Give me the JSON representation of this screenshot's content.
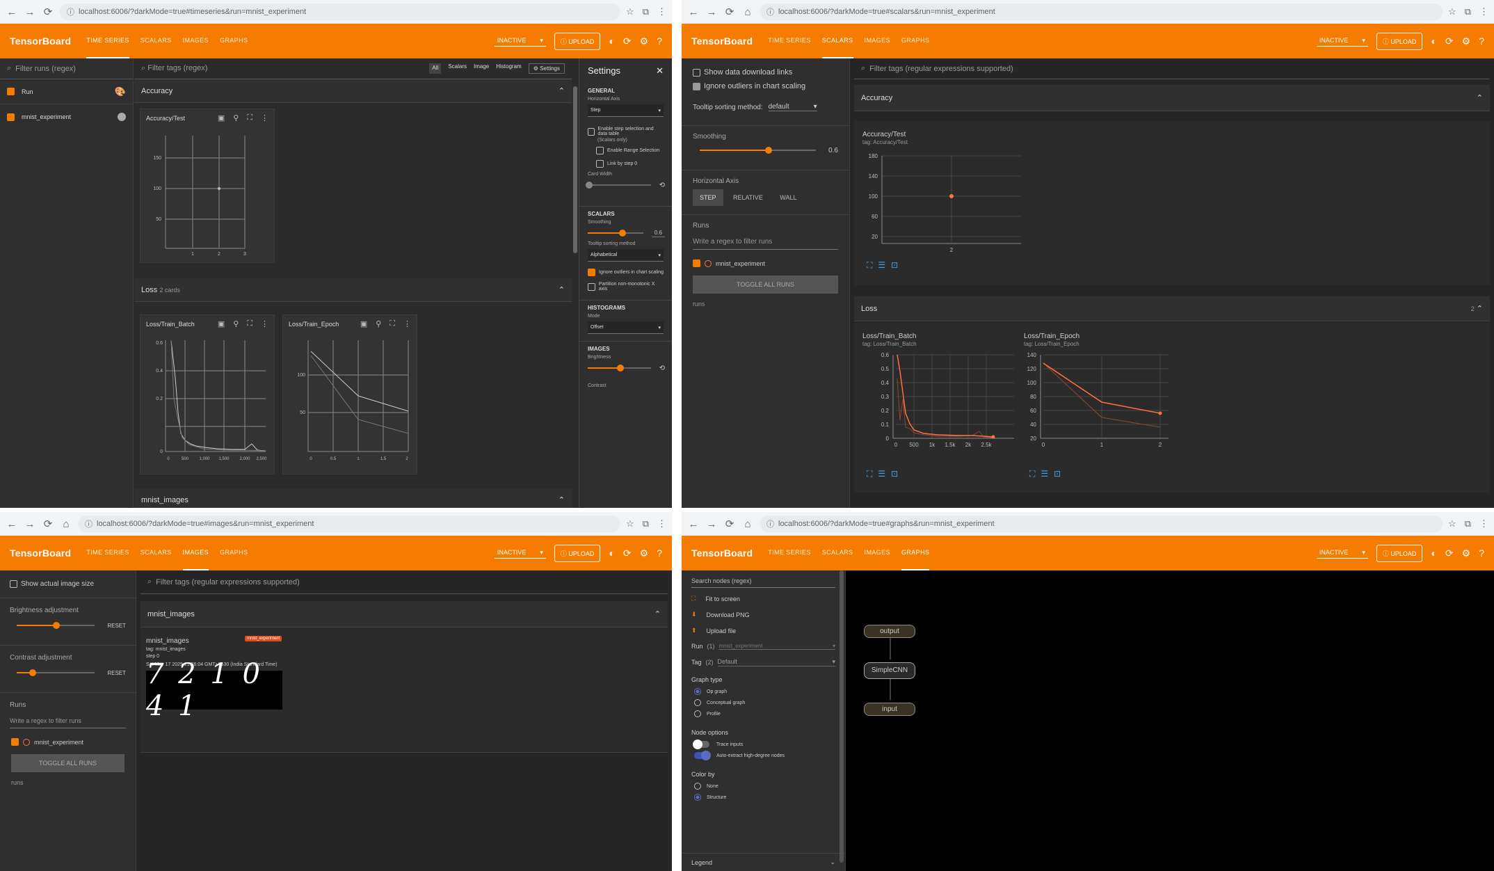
{
  "q1": {
    "url": "localhost:6006/?darkMode=true#timeseries&run=mnist_experiment",
    "brand": "TensorBoard",
    "tabs": [
      "TIME SERIES",
      "SCALARS",
      "IMAGES",
      "GRAPHS"
    ],
    "inactive": "INACTIVE",
    "upload": "UPLOAD",
    "filter_runs": "Filter runs (regex)",
    "runs": [
      "Run",
      "mnist_experiment"
    ],
    "filter_tags": "Filter tags (regex)",
    "type_tabs": [
      "All",
      "Scalars",
      "Image",
      "Histogram"
    ],
    "settings_btn": "Settings",
    "section_accuracy": "Accuracy",
    "accuracy_card": {
      "title": "Accuracy/Test",
      "yticks": [
        "150",
        "100",
        "50"
      ],
      "xticks": [
        "1",
        "2",
        "3"
      ]
    },
    "section_loss": "Loss",
    "section_loss_count": "2 cards",
    "loss_batch": {
      "title": "Loss/Train_Batch",
      "yticks": [
        "0.6",
        "0.4",
        "0.2",
        "0"
      ],
      "xticks": [
        "0",
        "500",
        "1,000",
        "1,500",
        "2,000",
        "2,500"
      ]
    },
    "loss_epoch": {
      "title": "Loss/Train_Epoch",
      "yticks": [
        "100",
        "50"
      ],
      "xticks": [
        "0",
        "0.5",
        "1",
        "1.5",
        "2"
      ]
    },
    "section_images": "mnist_images",
    "settings": {
      "title": "Settings",
      "general": "GENERAL",
      "horizontal_axis": "Horizontal Axis",
      "axis_value": "Step",
      "enable_step": "Enable step selection and data table",
      "scalars_only": "(Scalars only)",
      "enable_range": "Enable Range Selection",
      "link_step": "Link by step 0",
      "card_width": "Card Width",
      "scalars": "SCALARS",
      "smoothing": "Smoothing",
      "smoothing_value": "0.6",
      "tooltip_sort": "Tooltip sorting method",
      "tooltip_value": "Alphabetical",
      "ignore_outliers": "Ignore outliers in chart scaling",
      "partition": "Partition non-monotonic X axis",
      "histograms": "HISTOGRAMS",
      "mode": "Mode",
      "mode_value": "Offset",
      "images": "IMAGES",
      "brightness": "Brightness",
      "contrast": "Contrast"
    }
  },
  "q2": {
    "url": "localhost:6006/?darkMode=true#scalars&run=mnist_experiment",
    "brand": "TensorBoard",
    "tabs": [
      "TIME SERIES",
      "SCALARS",
      "IMAGES",
      "GRAPHS"
    ],
    "inactive": "INACTIVE",
    "upload": "UPLOAD",
    "show_download": "Show data download links",
    "ignore_outliers": "Ignore outliers in chart scaling",
    "tooltip_label": "Tooltip sorting method:",
    "tooltip_value": "default",
    "smoothing": "Smoothing",
    "smoothing_value": "0.6",
    "horizontal_axis": "Horizontal Axis",
    "axis_options": [
      "STEP",
      "RELATIVE",
      "WALL"
    ],
    "runs_label": "Runs",
    "runs_filter": "Write a regex to filter runs",
    "run_name": "mnist_experiment",
    "toggle_all": "TOGGLE ALL RUNS",
    "runs_footer": "runs",
    "filter_tags": "Filter tags (regular expressions supported)",
    "section_accuracy": "Accuracy",
    "acc_chart": {
      "title": "Accuracy/Test",
      "tag": "tag: Accuracy/Test",
      "yticks": [
        "180",
        "140",
        "100",
        "60",
        "20"
      ],
      "xticks": [
        "2"
      ]
    },
    "section_loss": "Loss",
    "section_loss_count": "2",
    "batch_chart": {
      "title": "Loss/Train_Batch",
      "tag": "tag: Loss/Train_Batch",
      "yticks": [
        "0.6",
        "0.5",
        "0.4",
        "0.3",
        "0.2",
        "0.1",
        "0"
      ],
      "xticks": [
        "0",
        "500",
        "1k",
        "1.5k",
        "2k",
        "2.5k"
      ]
    },
    "epoch_chart": {
      "title": "Loss/Train_Epoch",
      "tag": "tag: Loss/Train_Epoch",
      "yticks": [
        "140",
        "120",
        "100",
        "80",
        "60",
        "40",
        "20"
      ],
      "xticks": [
        "0",
        "1",
        "2"
      ]
    }
  },
  "q3": {
    "url": "localhost:6006/?darkMode=true#images&run=mnist_experiment",
    "brand": "TensorBoard",
    "tabs": [
      "TIME SERIES",
      "SCALARS",
      "IMAGES",
      "GRAPHS"
    ],
    "inactive": "INACTIVE",
    "upload": "UPLOAD",
    "show_actual": "Show actual image size",
    "brightness": "Brightness adjustment",
    "contrast": "Contrast adjustment",
    "reset": "RESET",
    "runs_label": "Runs",
    "runs_filter": "Write a regex to filter runs",
    "run_name": "mnist_experiment",
    "toggle_all": "TOGGLE ALL RUNS",
    "runs_footer": "runs",
    "filter_tags": "Filter tags (regular expressions supported)",
    "section": "mnist_images",
    "card_title": "mnist_images",
    "card_badge": "mnist_experiment",
    "card_tag": "tag: mnist_images",
    "card_step": "step 0",
    "card_time": "Sat May 17 2025 21:26:04 GMT+0530 (India Standard Time)",
    "digits": "7 2 1 0 4 1"
  },
  "q4": {
    "url": "localhost:6006/?darkMode=true#graphs&run=mnist_experiment",
    "brand": "TensorBoard",
    "tabs": [
      "TIME SERIES",
      "SCALARS",
      "IMAGES",
      "GRAPHS"
    ],
    "inactive": "INACTIVE",
    "upload": "UPLOAD",
    "search": "Search nodes (regex)",
    "fit": "Fit to screen",
    "download": "Download PNG",
    "upload_file": "Upload file",
    "run_label": "Run",
    "run_count": "(1)",
    "run_value": "mnist_experiment",
    "tag_label": "Tag",
    "tag_count": "(2)",
    "tag_value": "Default",
    "graph_type": "Graph type",
    "graph_types": [
      "Op graph",
      "Conceptual graph",
      "Profile"
    ],
    "node_options": "Node options",
    "trace_inputs": "Trace inputs",
    "auto_extract": "Auto-extract high-degree nodes",
    "color_by": "Color by",
    "color_options": [
      "None",
      "Structure"
    ],
    "legend": "Legend",
    "nodes": [
      "output",
      "SimpleCNN",
      "input"
    ]
  },
  "colors": {
    "accent": "#f57c00",
    "bg": "#2b2b2b",
    "line": "#ff7043"
  }
}
